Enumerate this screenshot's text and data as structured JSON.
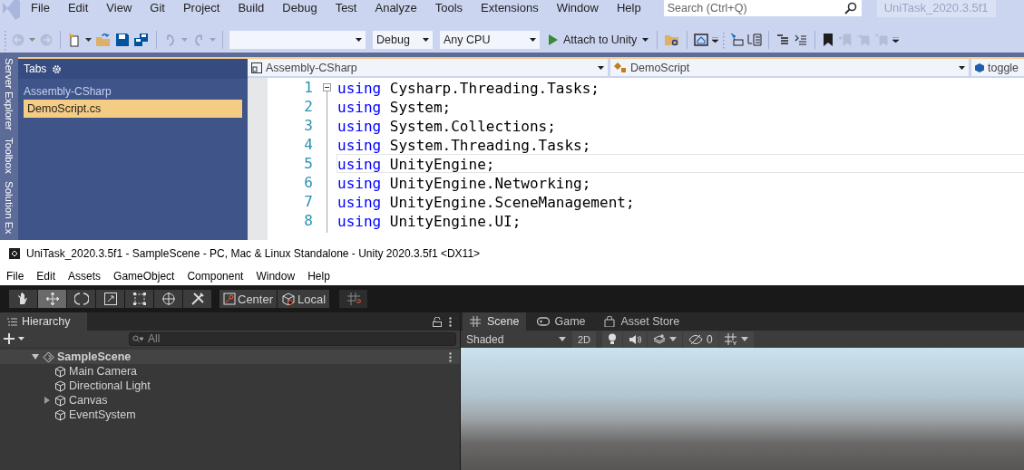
{
  "vs": {
    "menu": [
      "File",
      "Edit",
      "View",
      "Git",
      "Project",
      "Build",
      "Debug",
      "Test",
      "Analyze",
      "Tools",
      "Extensions",
      "Window",
      "Help"
    ],
    "search": {
      "placeholder": "Search (Ctrl+Q)"
    },
    "solution_name": "UniTask_2020.3.5f1",
    "toolbar": {
      "dropdowns": [
        {
          "value": "Debug"
        },
        {
          "value": "Any CPU"
        }
      ],
      "attach_button": "Attach to Unity"
    },
    "side_tabs": [
      "Server Explorer",
      "Toolbox",
      "Solution Ex"
    ],
    "tabs_panel": {
      "title": "Tabs",
      "groups": [
        {
          "name": "Assembly-CSharp",
          "items": [
            {
              "label": "DemoScript.cs",
              "selected": true
            }
          ]
        }
      ]
    },
    "nav_bar": {
      "project": "Assembly-CSharp",
      "type": "DemoScript",
      "member": "toggle"
    },
    "code": [
      {
        "number": "1",
        "keyword": "using",
        "text": "Cysharp.Threading.Tasks;",
        "current": false
      },
      {
        "number": "2",
        "keyword": "using",
        "text": "System;",
        "current": false
      },
      {
        "number": "3",
        "keyword": "using",
        "text": "System.Collections;",
        "current": false
      },
      {
        "number": "4",
        "keyword": "using",
        "text": "System.Threading.Tasks;",
        "current": false
      },
      {
        "number": "5",
        "keyword": "using",
        "text": "UnityEngine;",
        "current": true
      },
      {
        "number": "6",
        "keyword": "using",
        "text": "UnityEngine.Networking;",
        "current": false
      },
      {
        "number": "7",
        "keyword": "using",
        "text": "UnityEngine.SceneManagement;",
        "current": false
      },
      {
        "number": "8",
        "keyword": "using",
        "text": "UnityEngine.UI;",
        "current": false
      }
    ]
  },
  "unity": {
    "title": "UniTask_2020.3.5f1 - SampleScene - PC, Mac & Linux Standalone - Unity 2020.3.5f1 <DX11>",
    "menu": [
      "File",
      "Edit",
      "Assets",
      "GameObject",
      "Component",
      "Window",
      "Help"
    ],
    "tools": [
      {
        "kind": "hand",
        "selected": false
      },
      {
        "kind": "move",
        "selected": true
      },
      {
        "kind": "rotate",
        "selected": false
      },
      {
        "kind": "scale",
        "selected": false
      },
      {
        "kind": "rect",
        "selected": false
      },
      {
        "kind": "transform",
        "selected": false
      },
      {
        "kind": "custom",
        "selected": false
      }
    ],
    "pivot_mode": "Center",
    "pivot_rotation": "Local",
    "hierarchy": {
      "title": "Hierarchy",
      "search_placeholder": "All",
      "scene": {
        "name": "SampleScene",
        "expanded": true,
        "children": [
          {
            "name": "Main Camera"
          },
          {
            "name": "Directional Light"
          },
          {
            "name": "Canvas",
            "expanded": false,
            "has_children": true
          },
          {
            "name": "EventSystem"
          }
        ]
      }
    },
    "scene_view": {
      "tabs": [
        {
          "label": "Scene",
          "kind": "scene",
          "selected": true
        },
        {
          "label": "Game",
          "kind": "game",
          "selected": false
        },
        {
          "label": "Asset Store",
          "kind": "store",
          "selected": false
        }
      ],
      "shading": "Shaded",
      "mode_2d": "2D",
      "hidden_count": "0"
    }
  }
}
